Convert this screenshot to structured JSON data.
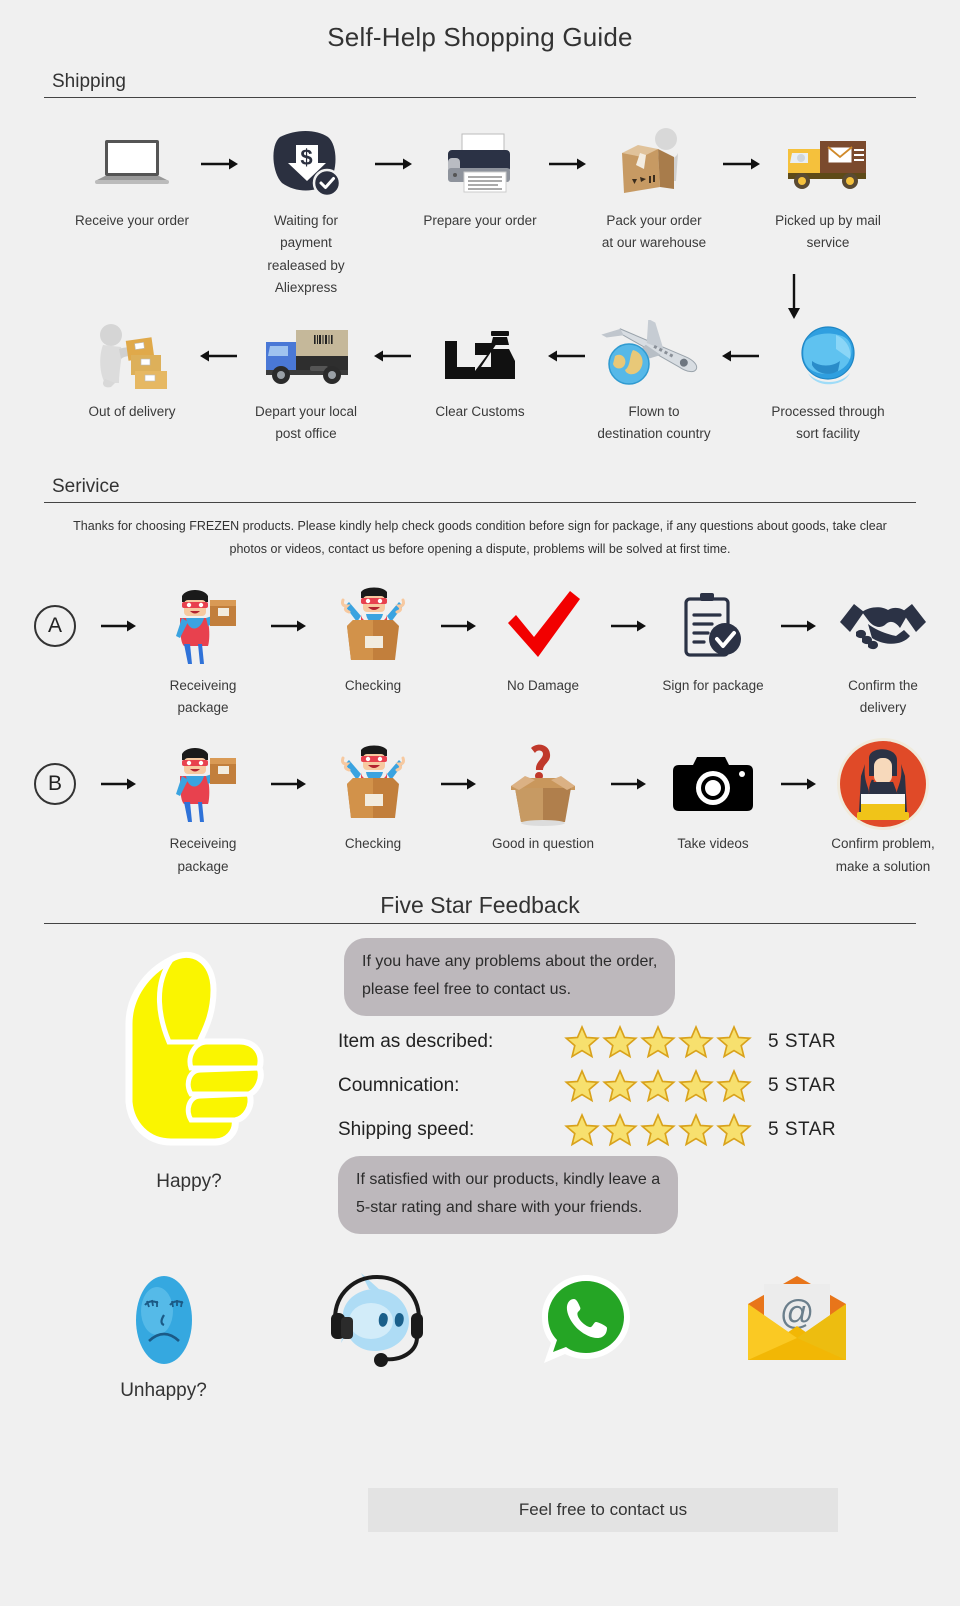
{
  "title": "Self-Help Shopping Guide",
  "shipping": {
    "heading": "Shipping",
    "row1": [
      {
        "icon": "laptop-icon",
        "label": "Receive your order"
      },
      {
        "icon": "payment-released-icon",
        "label": "Waiting for payment\nrealeased by Aliexpress"
      },
      {
        "icon": "printer-icon",
        "label": "Prepare your order"
      },
      {
        "icon": "packing-box-icon",
        "label": "Pack your order\nat our warehouse"
      },
      {
        "icon": "mail-truck-icon",
        "label": "Picked up by mail service"
      }
    ],
    "row2": [
      {
        "icon": "delivery-man-icon",
        "label": "Out of delivery"
      },
      {
        "icon": "blue-truck-icon",
        "label": "Depart your local\npost office"
      },
      {
        "icon": "customs-officer-icon",
        "label": "Clear Customs"
      },
      {
        "icon": "airplane-globe-icon",
        "label": "Flown to\ndestination country"
      },
      {
        "icon": "globe-sort-icon",
        "label": "Processed through\nsort facility"
      }
    ]
  },
  "service": {
    "heading": "Serivice",
    "note": "Thanks for choosing FREZEN products. Please kindly help check goods condition before sign for package, if any questions about goods, take clear photos or videos, contact us before opening a dispute, problems will be solved at first time.",
    "rowA": {
      "badge": "A",
      "steps": [
        {
          "icon": "hero-with-package-icon",
          "label": "Receiveing package"
        },
        {
          "icon": "hero-in-box-icon",
          "label": "Checking"
        },
        {
          "icon": "red-check-icon",
          "label": "No Damage"
        },
        {
          "icon": "clipboard-check-icon",
          "label": "Sign for package"
        },
        {
          "icon": "handshake-icon",
          "label": "Confirm the delivery"
        }
      ]
    },
    "rowB": {
      "badge": "B",
      "steps": [
        {
          "icon": "hero-with-package-icon",
          "label": "Receiveing package"
        },
        {
          "icon": "hero-in-box-icon",
          "label": "Checking"
        },
        {
          "icon": "question-box-icon",
          "label": "Good in question"
        },
        {
          "icon": "camera-icon",
          "label": "Take videos"
        },
        {
          "icon": "support-agent-icon",
          "label": "Confirm problem,\nmake a solution"
        }
      ]
    }
  },
  "feedback": {
    "title": "Five Star Feedback",
    "thumb_icon": "thumbs-up-icon",
    "thumb_caption": "Happy?",
    "bubble_top": "If you have any problems about the order,\nplease feel free to contact us.",
    "bubble_bottom": "If  satisfied with our products, kindly leave a\n5-star rating and share with your friends.",
    "ratings": [
      {
        "label": "Item as described:",
        "stars": 5,
        "value": "5 STAR"
      },
      {
        "label": "Coumnication:",
        "stars": 5,
        "value": "5 STAR"
      },
      {
        "label": "Shipping speed:",
        "stars": 5,
        "value": "5 STAR"
      }
    ]
  },
  "contact": {
    "items": [
      {
        "icon": "sad-face-icon",
        "label": "Unhappy?"
      },
      {
        "icon": "trademanager-headset-icon",
        "label": ""
      },
      {
        "icon": "whatsapp-icon",
        "label": ""
      },
      {
        "icon": "email-at-icon",
        "label": ""
      }
    ],
    "footer": "Feel free to contact us"
  },
  "colors": {
    "background": "#f0f0f0",
    "bubble": "#bdb8bc",
    "footer_bar": "#e3e3e3",
    "star_yellow": "#f5c842",
    "thumb_yellow": "#faf500",
    "red_check": "#f20000",
    "whatsapp_green": "#25a525",
    "agent_red": "#e04a28",
    "truck_yellow": "#f5c13c",
    "truck_blue": "#4a78d6"
  }
}
